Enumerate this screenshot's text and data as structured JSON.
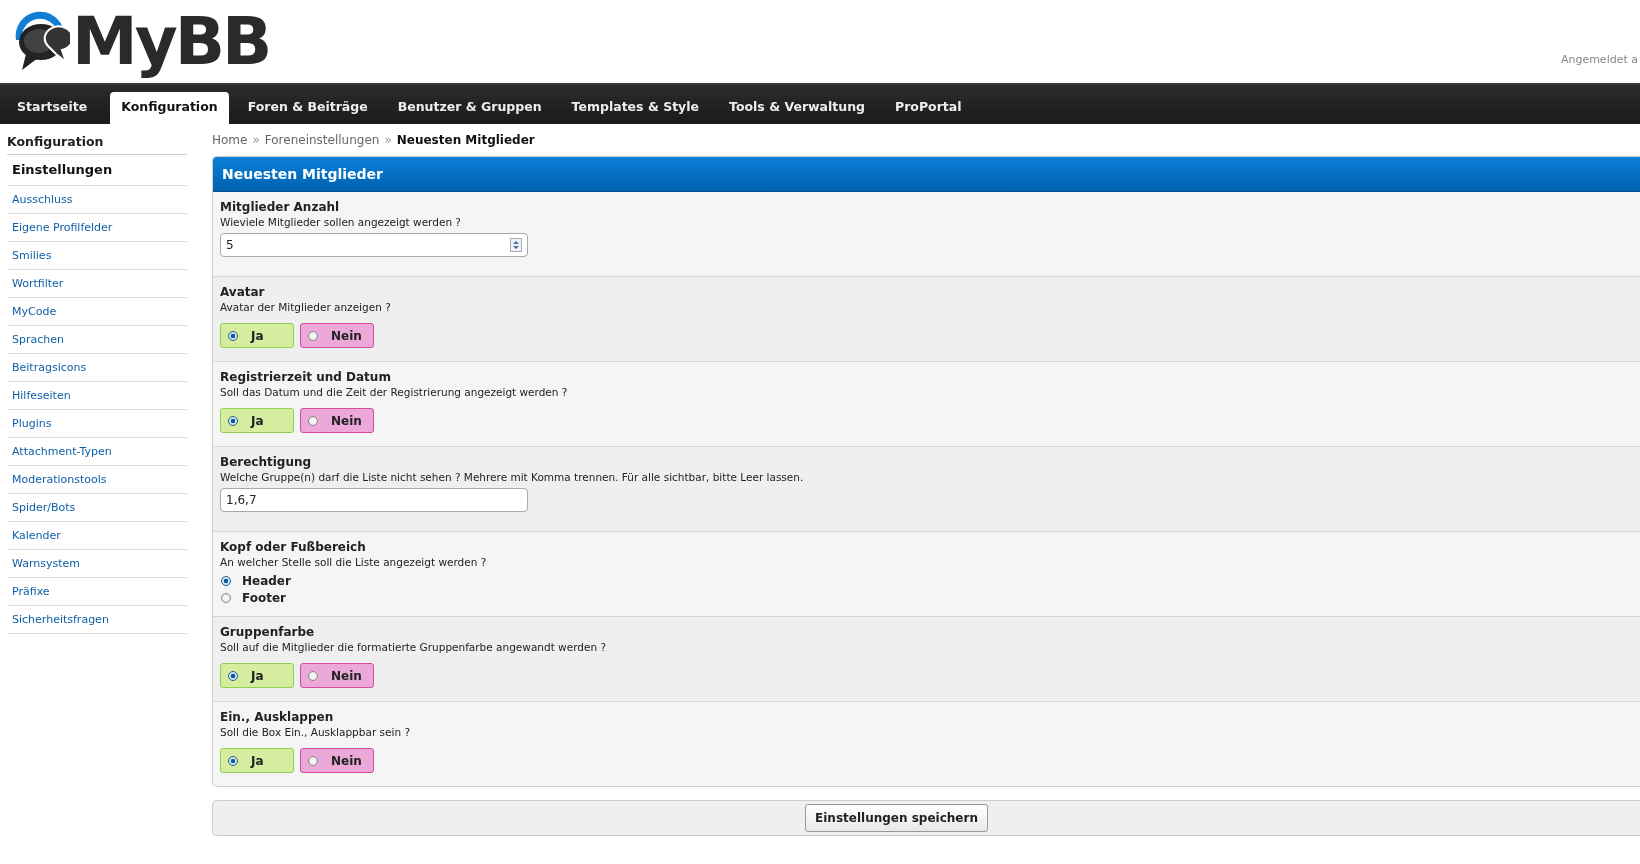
{
  "header": {
    "logo_text": "MyBB",
    "login_text": "Angemeldet a"
  },
  "nav": {
    "tabs": [
      {
        "label": "Startseite",
        "selected": false
      },
      {
        "label": "Konfiguration",
        "selected": true
      },
      {
        "label": "Foren & Beiträge",
        "selected": false
      },
      {
        "label": "Benutzer & Gruppen",
        "selected": false
      },
      {
        "label": "Templates & Style",
        "selected": false
      },
      {
        "label": "Tools & Verwaltung",
        "selected": false
      },
      {
        "label": "ProPortal",
        "selected": false
      }
    ]
  },
  "sidebar": {
    "title": "Konfiguration",
    "items": [
      {
        "label": "Einstellungen",
        "selected": true
      },
      {
        "label": "Ausschluss",
        "selected": false
      },
      {
        "label": "Eigene Profilfelder",
        "selected": false
      },
      {
        "label": "Smilies",
        "selected": false
      },
      {
        "label": "Wortfilter",
        "selected": false
      },
      {
        "label": "MyCode",
        "selected": false
      },
      {
        "label": "Sprachen",
        "selected": false
      },
      {
        "label": "Beitragsicons",
        "selected": false
      },
      {
        "label": "Hilfeseiten",
        "selected": false
      },
      {
        "label": "Plugins",
        "selected": false
      },
      {
        "label": "Attachment-Typen",
        "selected": false
      },
      {
        "label": "Moderationstools",
        "selected": false
      },
      {
        "label": "Spider/Bots",
        "selected": false
      },
      {
        "label": "Kalender",
        "selected": false
      },
      {
        "label": "Warnsystem",
        "selected": false
      },
      {
        "label": "Präfixe",
        "selected": false
      },
      {
        "label": "Sicherheitsfragen",
        "selected": false
      }
    ]
  },
  "breadcrumb": [
    {
      "label": "Home",
      "current": false
    },
    {
      "label": "Foreneinstellungen",
      "current": false
    },
    {
      "label": "Neuesten Mitglieder",
      "current": true
    }
  ],
  "breadcrumb_separator": "»",
  "panel": {
    "title": "Neuesten Mitglieder",
    "settings": [
      {
        "kind": "number",
        "title": "Mitglieder Anzahl",
        "description": "Wieviele Mitglieder sollen angezeigt werden ?",
        "value": "5"
      },
      {
        "kind": "yesno",
        "title": "Avatar",
        "description": "Avatar der Mitglieder anzeigen ?",
        "options": [
          {
            "label": "Ja",
            "selected": true
          },
          {
            "label": "Nein",
            "selected": false
          }
        ]
      },
      {
        "kind": "yesno",
        "title": "Registrierzeit und Datum",
        "description": "Soll das Datum und die Zeit der Registrierung angezeigt werden ?",
        "options": [
          {
            "label": "Ja",
            "selected": true
          },
          {
            "label": "Nein",
            "selected": false
          }
        ]
      },
      {
        "kind": "text",
        "title": "Berechtigung",
        "description": "Welche Gruppe(n) darf die Liste nicht sehen ? Mehrere mit Komma trennen. Für alle sichtbar, bitte Leer lassen.",
        "value": "1,6,7"
      },
      {
        "kind": "radio",
        "title": "Kopf oder Fußbereich",
        "description": "An welcher Stelle soll die Liste angezeigt werden ?",
        "options": [
          {
            "label": "Header",
            "selected": true
          },
          {
            "label": "Footer",
            "selected": false
          }
        ]
      },
      {
        "kind": "yesno",
        "title": "Gruppenfarbe",
        "description": "Soll auf die Mitglieder die formatierte Gruppenfarbe angewandt werden ?",
        "options": [
          {
            "label": "Ja",
            "selected": true
          },
          {
            "label": "Nein",
            "selected": false
          }
        ]
      },
      {
        "kind": "yesno",
        "title": "Ein., Ausklappen",
        "description": "Soll die Box Ein., Ausklappbar sein ?",
        "options": [
          {
            "label": "Ja",
            "selected": true
          },
          {
            "label": "Nein",
            "selected": false
          }
        ]
      }
    ]
  },
  "save_button": "Einstellungen speichern"
}
